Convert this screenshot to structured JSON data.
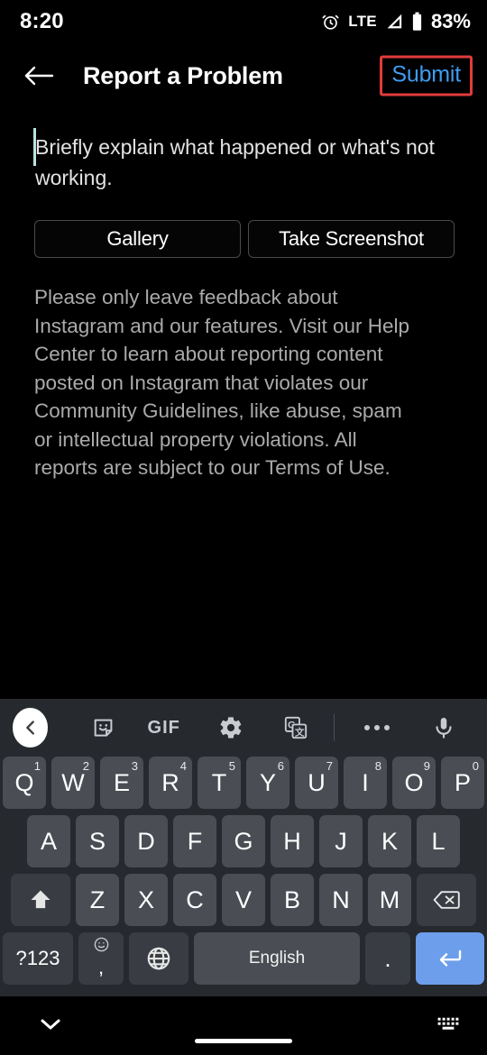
{
  "status_bar": {
    "time": "8:20",
    "alarm_icon": "alarm-clock-icon",
    "network": "LTE",
    "signal_icon": "signal-triangle-icon",
    "battery_icon": "battery-icon",
    "battery_percent": "83%"
  },
  "app_bar": {
    "back_icon": "back-arrow-icon",
    "title": "Report a Problem",
    "submit_label": "Submit",
    "submit_color": "#3f9bf0",
    "highlight_color": "#e23b3b"
  },
  "form": {
    "textarea_placeholder": "Briefly explain what happened or what's not working.",
    "caret_color": "#b9e4de",
    "gallery_button": "Gallery",
    "screenshot_button": "Take Screenshot",
    "disclaimer": "Please only leave feedback about Instagram and our features. Visit our Help Center to learn about reporting content posted on Instagram that violates our Community Guidelines, like abuse, spam or intellectual property violations. All reports are subject to our Terms of Use."
  },
  "keyboard": {
    "background": "#26292e",
    "key_color": "#4a4e54",
    "modifier_key_color": "#393d43",
    "enter_key_color": "#6d9eeb",
    "toolbar": {
      "collapse_icon": "chevron-left-icon",
      "sticker_icon": "sticker-icon",
      "gif_label": "GIF",
      "settings_icon": "gear-icon",
      "translate_icon": "google-translate-icon",
      "more_icon": "more-dots-icon",
      "mic_icon": "microphone-icon"
    },
    "row1": [
      {
        "label": "Q",
        "sup": "1"
      },
      {
        "label": "W",
        "sup": "2"
      },
      {
        "label": "E",
        "sup": "3"
      },
      {
        "label": "R",
        "sup": "4"
      },
      {
        "label": "T",
        "sup": "5"
      },
      {
        "label": "Y",
        "sup": "6"
      },
      {
        "label": "U",
        "sup": "7"
      },
      {
        "label": "I",
        "sup": "8"
      },
      {
        "label": "O",
        "sup": "9"
      },
      {
        "label": "P",
        "sup": "0"
      }
    ],
    "row2": [
      {
        "label": "A"
      },
      {
        "label": "S"
      },
      {
        "label": "D"
      },
      {
        "label": "F"
      },
      {
        "label": "G"
      },
      {
        "label": "H"
      },
      {
        "label": "J"
      },
      {
        "label": "K"
      },
      {
        "label": "L"
      }
    ],
    "row3": {
      "shift_icon": "shift-up-arrow-icon",
      "letters": [
        {
          "label": "Z"
        },
        {
          "label": "X"
        },
        {
          "label": "C"
        },
        {
          "label": "V"
        },
        {
          "label": "B"
        },
        {
          "label": "N"
        },
        {
          "label": "M"
        }
      ],
      "backspace_icon": "backspace-icon"
    },
    "row4": {
      "symbols_label": "?123",
      "emoji_icon": "emoji-smiley-icon",
      "comma_label": ",",
      "language_icon": "globe-icon",
      "space_label": "English",
      "period_label": ".",
      "enter_icon": "enter-return-icon"
    }
  },
  "nav_bar": {
    "hide_keyboard_icon": "chevron-down-icon",
    "home_indicator": "home-gesture-bar",
    "switch_keyboard_icon": "keyboard-switcher-icon"
  }
}
